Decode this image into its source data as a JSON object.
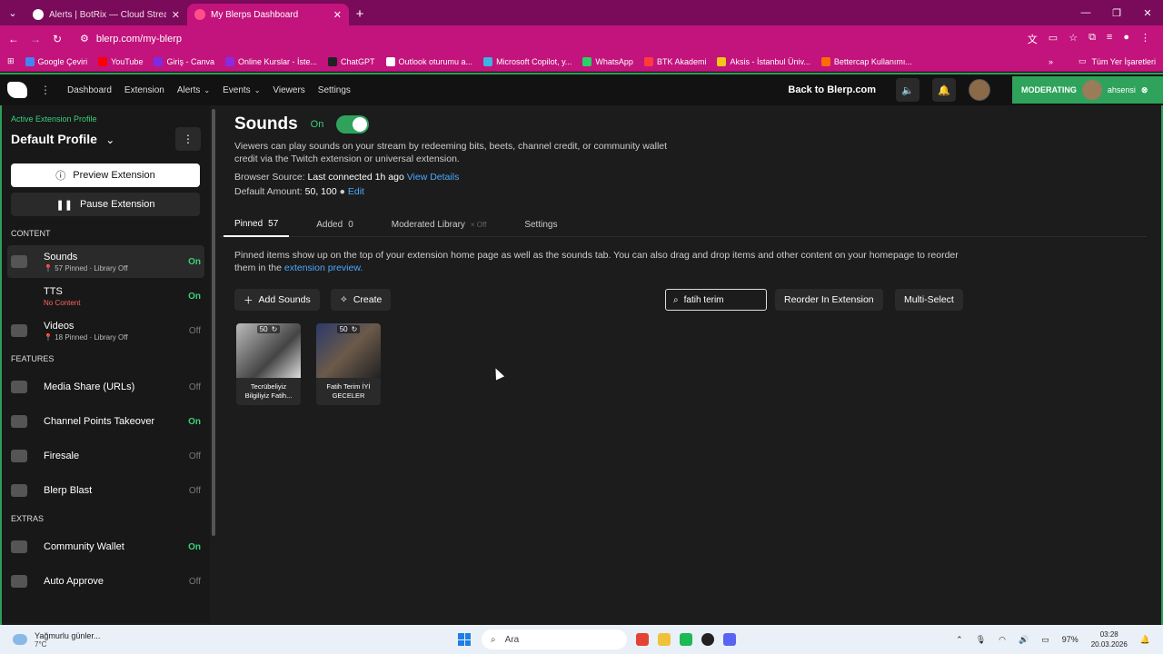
{
  "browser": {
    "tabs": [
      {
        "title": "Alerts | BotRix — Cloud Streami",
        "active": false
      },
      {
        "title": "My Blerps Dashboard",
        "active": true
      }
    ],
    "url": "blerp.com/my-blerp",
    "bookmarks": [
      "Google Çeviri",
      "YouTube",
      "Giriş - Canva",
      "Online Kurslar - İste...",
      "ChatGPT",
      "Outlook oturumu a...",
      "Microsoft Copilot, y...",
      "WhatsApp",
      "BTK Akademi",
      "Aksis - İstanbul Üniv...",
      "Bettercap Kullanımı..."
    ],
    "all_bookmarks": "Tüm Yer İşaretleri"
  },
  "topnav": {
    "links": [
      "Dashboard",
      "Extension",
      "Alerts",
      "Events",
      "Viewers",
      "Settings"
    ],
    "back": "Back to Blerp.com",
    "moderating": "MODERATING",
    "moderator_name": "ahsensi"
  },
  "sidebar": {
    "profile_label": "Active Extension Profile",
    "profile_name": "Default Profile",
    "preview": "Preview Extension",
    "pause": "Pause Extension",
    "sections": [
      {
        "title": "CONTENT",
        "items": [
          {
            "label": "Sounds",
            "sub1": "57 Pinned",
            "sub2": "Library Off",
            "status": "On",
            "selected": true
          },
          {
            "label": "TTS",
            "sub1": "No Content",
            "sub2": "",
            "status": "On",
            "selected": false
          },
          {
            "label": "Videos",
            "sub1": "18 Pinned",
            "sub2": "Library Off",
            "status": "Off",
            "selected": false
          }
        ]
      },
      {
        "title": "FEATURES",
        "items": [
          {
            "label": "Media Share (URLs)",
            "status": "Off"
          },
          {
            "label": "Channel Points Takeover",
            "status": "On"
          },
          {
            "label": "Firesale",
            "status": "Off"
          },
          {
            "label": "Blerp Blast",
            "status": "Off"
          }
        ]
      },
      {
        "title": "EXTRAS",
        "items": [
          {
            "label": "Community Wallet",
            "status": "On"
          },
          {
            "label": "Auto Approve",
            "status": "Off"
          }
        ]
      }
    ]
  },
  "main": {
    "title": "Sounds",
    "toggle_label": "On",
    "description": "Viewers can play sounds on your stream by redeeming bits, beets, channel credit, or community wallet credit via the Twitch extension or universal extension.",
    "browser_source_label": "Browser Source:",
    "browser_source_value": "Last connected 1h ago",
    "view_details": "View Details",
    "default_amount_label": "Default Amount:",
    "default_amount_value": "50, 100",
    "edit": "Edit",
    "tabs": [
      {
        "label": "Pinned",
        "count": "57",
        "active": true
      },
      {
        "label": "Added",
        "count": "0",
        "active": false
      },
      {
        "label": "Moderated Library",
        "count": "× Off",
        "active": false
      },
      {
        "label": "Settings",
        "count": "",
        "active": false
      }
    ],
    "note": "Pinned items show up on the top of your extension home page as well as the sounds tab. You can also drag and drop items and other content on your homepage to reorder them in the",
    "note_link": "extension preview.",
    "add_sounds": "Add Sounds",
    "create": "Create",
    "search_value": "fatih terim",
    "reorder": "Reorder In Extension",
    "multi_select": "Multi-Select",
    "cards": [
      {
        "price": "50",
        "caption": "Tecrübeliyiz Bilgiliyiz Fatih..."
      },
      {
        "price": "50",
        "caption": "Fatih Terim İYİ GECELER"
      }
    ]
  },
  "taskbar": {
    "weather_line1": "Yağmurlu günler...",
    "weather_line2": "7°C",
    "search": "Ara",
    "battery": "97%",
    "time": "03:28",
    "date": "20.03.2026"
  }
}
